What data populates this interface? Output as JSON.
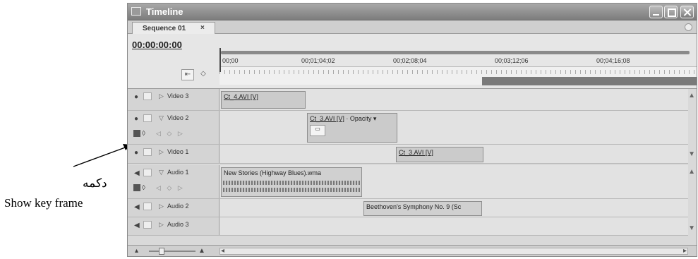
{
  "window": {
    "title": "Timeline",
    "tab_label": "Sequence 01",
    "tab_close": "×"
  },
  "header": {
    "timecode": "00:00:00:00",
    "ruler_labels": [
      "00;00",
      "00;01;04;02",
      "00;02;08;04",
      "00;03;12;06",
      "00;04;16;08"
    ]
  },
  "tracks": {
    "video3": {
      "name": "Video 3",
      "clip": "Ct_4.AVI [V]"
    },
    "video2": {
      "name": "Video 2",
      "clip": "Ct_3.AVI [V]",
      "clip_suffix": " · Opacity ▾"
    },
    "video1": {
      "name": "Video 1",
      "clip": "Ct_3.AVI [V]"
    },
    "audio1": {
      "name": "Audio 1",
      "clip": "New Stories (Highway Blues).wma"
    },
    "audio2": {
      "name": "Audio 2",
      "clip": "Beethoven's Symphony No. 9 (Sc"
    },
    "audio3": {
      "name": "Audio 3"
    }
  },
  "annotation": {
    "label_fa": "دکمه",
    "label_en": "Show key frame"
  },
  "colors": {
    "titlebar": "#8a8a8a",
    "window_bg": "#d9d9d9",
    "lane_bg": "#e2e2e2"
  }
}
